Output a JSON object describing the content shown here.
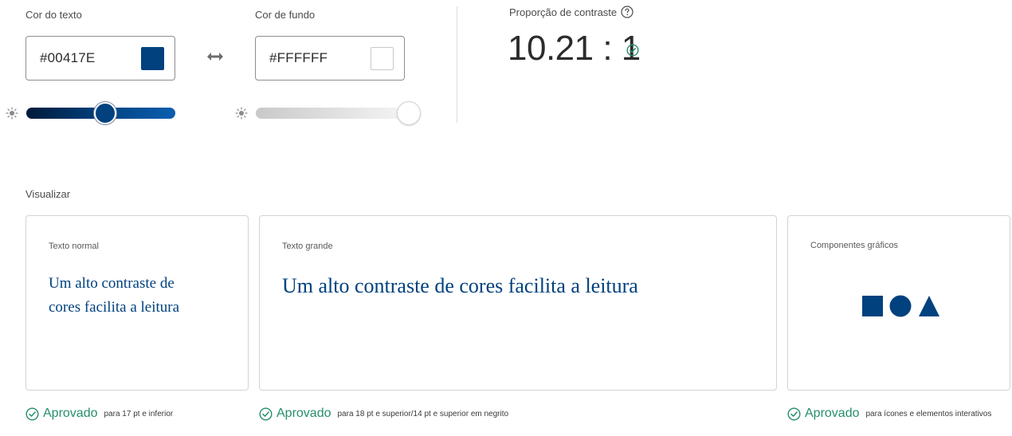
{
  "text_color": {
    "label": "Cor do texto",
    "hex": "#00417E",
    "swatch_color": "#00417E"
  },
  "background_color": {
    "label": "Cor de fundo",
    "hex": "#FFFFFF",
    "swatch_color": "#FFFFFF"
  },
  "contrast": {
    "label": "Proporção de contraste",
    "value": "10.21 : 1"
  },
  "preview": {
    "label": "Visualizar",
    "normal": {
      "title": "Texto normal",
      "sample": "Um alto contraste de cores facilita a leitura"
    },
    "large": {
      "title": "Texto grande",
      "sample": "Um alto contraste de cores facilita a leitura"
    },
    "graphics": {
      "title": "Componentes gráficos"
    }
  },
  "results": [
    {
      "status": "Aprovado",
      "note": "para 17 pt e inferior"
    },
    {
      "status": "Aprovado",
      "note": "para 18 pt e superior/14 pt e superior em negrito"
    },
    {
      "status": "Aprovado",
      "note": "para ícones e elementos interativos"
    }
  ],
  "colors": {
    "brand": "#00417E",
    "pass_green": "#268e6c",
    "text": "#2c2c2c",
    "border": "#d3d3d3"
  },
  "icons": [
    "sun-icon",
    "swap-arrows-icon",
    "help-icon",
    "check-circle-icon",
    "square-icon",
    "circle-icon",
    "triangle-icon"
  ]
}
